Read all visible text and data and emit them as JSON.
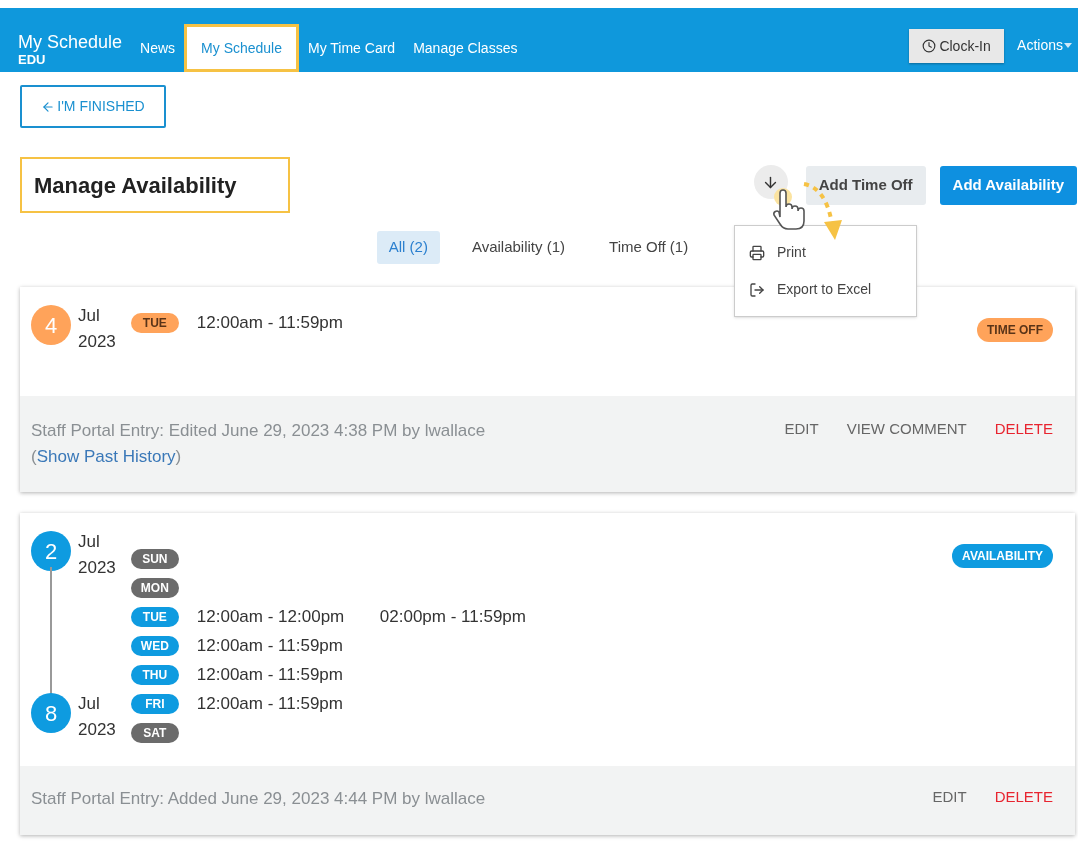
{
  "header": {
    "app_title": "My Schedule",
    "app_subtitle": "EDU",
    "nav": [
      {
        "label": "News",
        "selected": false,
        "highlighted": false
      },
      {
        "label": "My Schedule",
        "selected": true,
        "highlighted": true
      },
      {
        "label": "My Time Card",
        "selected": false,
        "highlighted": false
      },
      {
        "label": "Manage Classes",
        "selected": false,
        "highlighted": false
      }
    ],
    "clock_in": "Clock-In",
    "actions": "Actions"
  },
  "back_button": "I'M FINISHED",
  "page_title": {
    "text": "Manage Availability",
    "highlighted": true
  },
  "toolbar": [
    {
      "label": "Add Time Off",
      "kind": "secondary"
    },
    {
      "label": "Add Availability",
      "kind": "primary"
    }
  ],
  "export_menu": {
    "open": true,
    "items": [
      {
        "label": "Print",
        "kind": "print"
      },
      {
        "label": "Export to Excel",
        "kind": "export"
      }
    ]
  },
  "filters": [
    {
      "label": "All (2)",
      "selected": true
    },
    {
      "label": "Availability (1)",
      "selected": false
    },
    {
      "label": "Time Off (1)",
      "selected": false
    }
  ],
  "entries": [
    {
      "kind": "time_off",
      "color": "#ffa35a",
      "status": "TIME OFF",
      "start": {
        "day": "4",
        "month": "Jul",
        "year": "2023"
      },
      "days": [
        {
          "label": "TUE",
          "available": true,
          "times": [
            "12:00am - 11:59pm"
          ]
        }
      ],
      "footer": {
        "text": "Staff Portal Entry: Edited June 29, 2023 4:38 PM by lwallace (",
        "link": "Show Past History",
        "after": ")"
      },
      "actions": [
        {
          "label": "EDIT",
          "kind": "normal"
        },
        {
          "label": "VIEW COMMENT",
          "kind": "normal"
        },
        {
          "label": "DELETE",
          "kind": "danger"
        }
      ]
    },
    {
      "kind": "availability",
      "color": "#0e9be0",
      "status": "AVAILABILITY",
      "start": {
        "day": "2",
        "month": "Jul",
        "year": "2023"
      },
      "end": {
        "day": "8",
        "month": "Jul",
        "year": "2023"
      },
      "days": [
        {
          "label": "SUN",
          "available": false
        },
        {
          "label": "MON",
          "available": false
        },
        {
          "label": "TUE",
          "available": true,
          "times": [
            "12:00am - 12:00pm",
            "02:00pm - 11:59pm"
          ]
        },
        {
          "label": "WED",
          "available": true,
          "times": [
            "12:00am - 11:59pm"
          ]
        },
        {
          "label": "THU",
          "available": true,
          "times": [
            "12:00am - 11:59pm"
          ]
        },
        {
          "label": "FRI",
          "available": true,
          "times": [
            "12:00am - 11:59pm"
          ]
        },
        {
          "label": "SAT",
          "available": false
        }
      ],
      "footer": {
        "text": "Staff Portal Entry: Added June 29, 2023 4:44 PM by lwallace"
      },
      "actions": [
        {
          "label": "EDIT",
          "kind": "normal"
        },
        {
          "label": "DELETE",
          "kind": "danger"
        }
      ]
    }
  ]
}
